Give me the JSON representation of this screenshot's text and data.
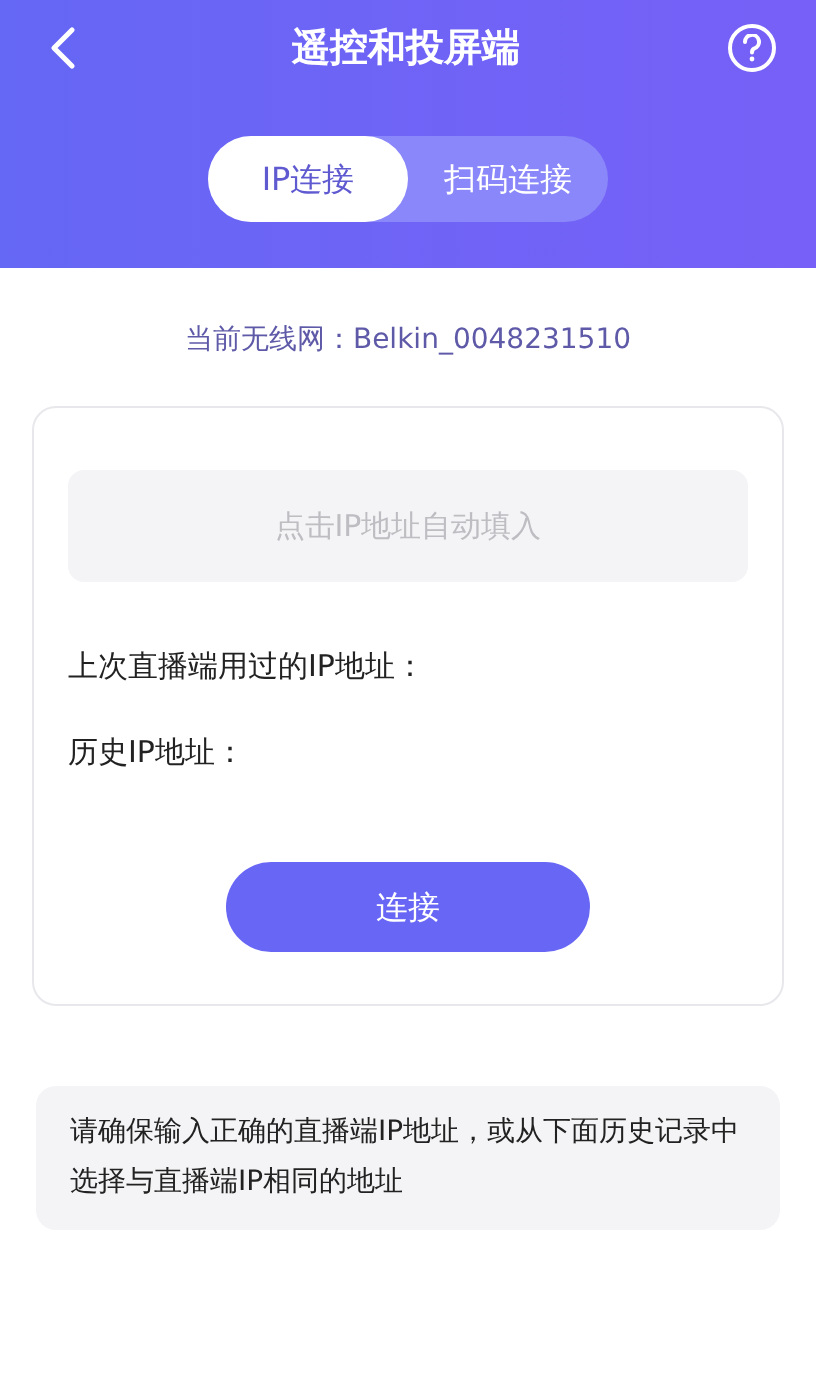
{
  "header": {
    "title": "遥控和投屏端"
  },
  "tabs": [
    {
      "label": "IP连接",
      "selected": true
    },
    {
      "label": "扫码连接",
      "selected": false
    }
  ],
  "wifi": {
    "text": "当前无线网：Belkin_0048231510"
  },
  "form": {
    "placeholder": "点击IP地址自动填入",
    "last_label": "上次直播端用过的IP地址：",
    "history_label": "历史IP地址：",
    "button": "连接"
  },
  "note": "请确保输入正确的直播端IP地址，或从下面历史记录中选择与直播端IP相同的地址"
}
